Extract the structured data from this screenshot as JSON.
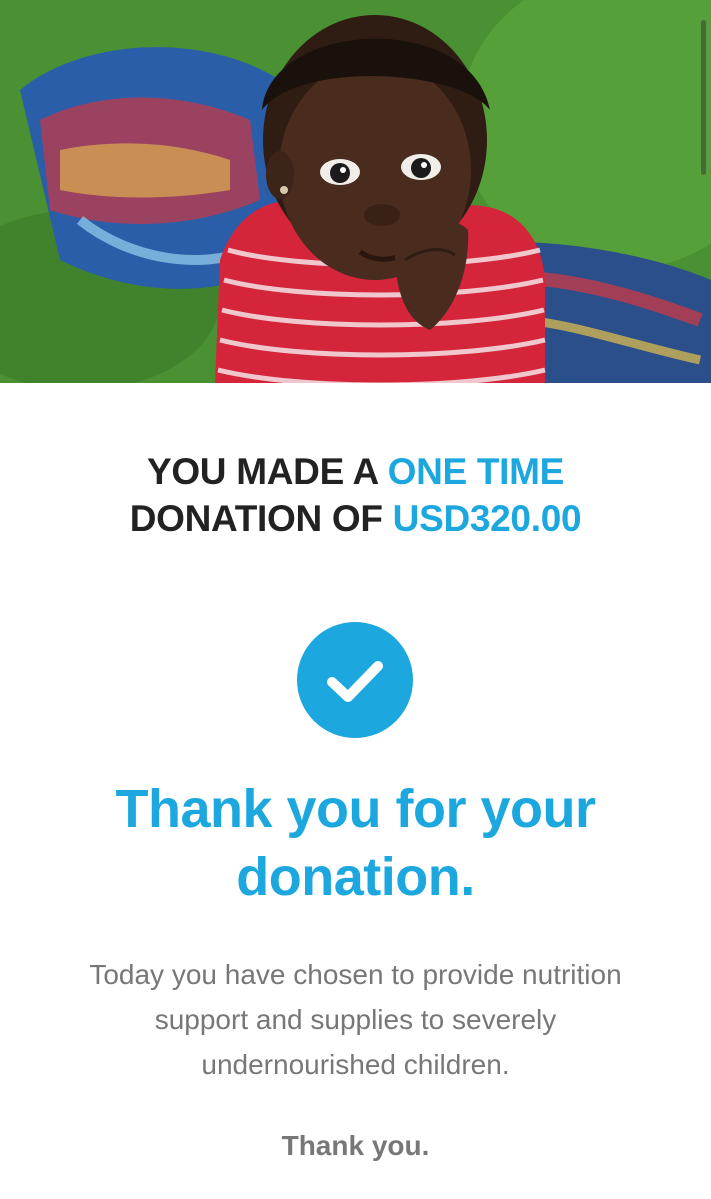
{
  "hero": {
    "image_subject": "child-photo"
  },
  "headline": {
    "line1_prefix": "YOU MADE A ",
    "line1_accent": "ONE TIME",
    "line2_prefix": "DONATION OF ",
    "line2_accent": "USD320.00"
  },
  "confirmation": {
    "icon": "checkmark-icon"
  },
  "thanks": {
    "title_line1": "Thank you for your",
    "title_line2": "donation."
  },
  "message": {
    "line1": "Today you have chosen to provide nutrition",
    "line2": "support and supplies to severely",
    "line3": "undernourished children."
  },
  "signoff": {
    "text": "Thank you."
  },
  "colors": {
    "accent": "#1ca7de",
    "heading_dark": "#222222",
    "body_gray": "#777777"
  }
}
